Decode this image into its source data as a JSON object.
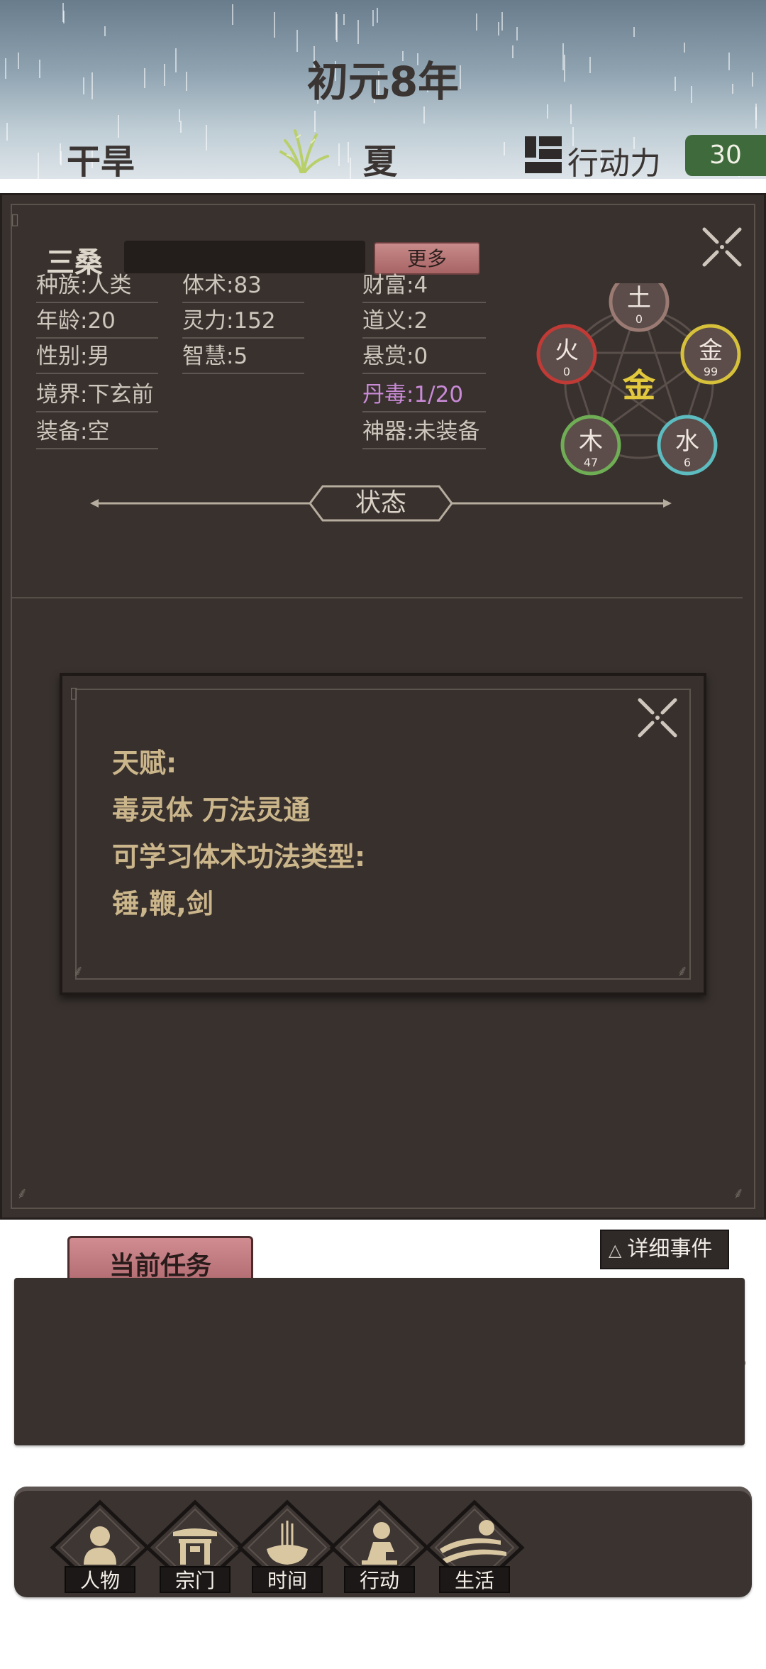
{
  "header": {
    "title": "初元8年",
    "weather": "干旱",
    "season": "夏",
    "action_label": "行动力",
    "action_value": "30"
  },
  "character": {
    "name": "三桑",
    "more_label": "更多",
    "stats_col1": [
      "种族:人类",
      "年龄:20",
      "性别:男",
      "境界:下玄前",
      "装备:空"
    ],
    "stats_col2": [
      "体术:83",
      "灵力:152",
      "智慧:5"
    ],
    "stats_col3": [
      "财富:4",
      "道义:2",
      "悬赏:0",
      "丹毒:1/20",
      "神器:未装备"
    ]
  },
  "wuxing": {
    "center": "金",
    "elements": [
      {
        "name": "土",
        "value": "0",
        "color": "#9a7a72"
      },
      {
        "name": "金",
        "value": "99",
        "color": "#d7c13a"
      },
      {
        "name": "水",
        "value": "6",
        "color": "#5cbcc0"
      },
      {
        "name": "木",
        "value": "47",
        "color": "#6fae55"
      },
      {
        "name": "火",
        "value": "0",
        "color": "#c03a36"
      }
    ]
  },
  "status_title": "状态",
  "talent_popup": {
    "title": "天赋:",
    "talents": "毒灵体  万法灵通",
    "weapon_title": "可学习体术功法类型:",
    "weapons": "锤,鞭,剑"
  },
  "task_button": "当前任务",
  "events": {
    "detail_label": "详细事件"
  },
  "nav": [
    {
      "label": "人物",
      "icon": "person-icon"
    },
    {
      "label": "宗门",
      "icon": "sect-gate-icon"
    },
    {
      "label": "时间",
      "icon": "incense-icon"
    },
    {
      "label": "行动",
      "icon": "action-icon"
    },
    {
      "label": "生活",
      "icon": "landscape-icon"
    }
  ],
  "colors": {
    "panel": "#38312e",
    "accent_pink": "#c88a8a",
    "gold_text": "#cbb58a",
    "poison_text": "#c98ad6",
    "action_green": "#3e6a3c"
  }
}
